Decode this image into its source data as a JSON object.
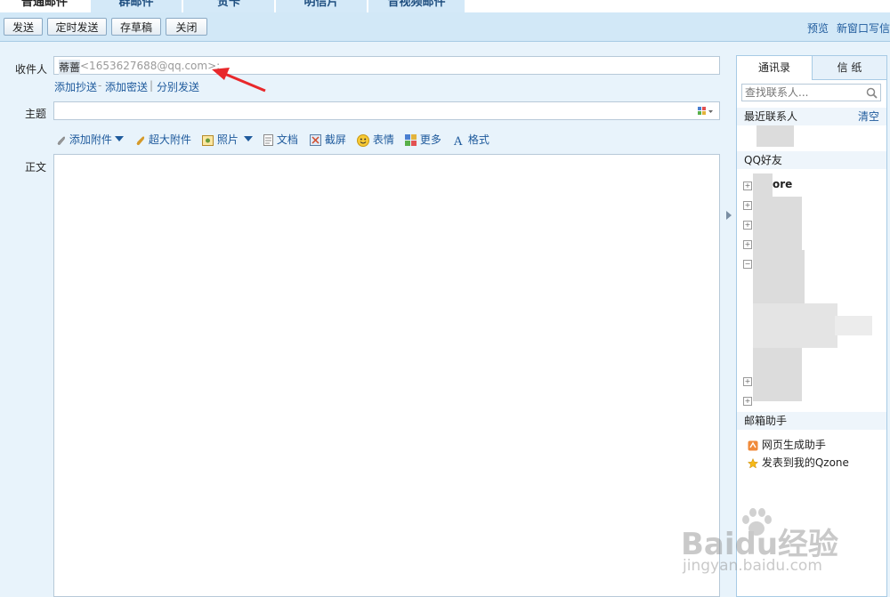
{
  "tabs": [
    "普通邮件",
    "群邮件",
    "贺卡",
    "明信片",
    "音视频邮件"
  ],
  "toolbar": {
    "send": "发送",
    "schedule_send": "定时发送",
    "save_draft": "存草稿",
    "close": "关闭",
    "preview": "预览",
    "new_window": "新窗口写信"
  },
  "compose": {
    "recipient_label": "收件人",
    "recipient_name": "蒂蔷",
    "recipient_email": "<1653627688@qq.com>;",
    "add_cc": "添加抄送",
    "add_bcc": "添加密送",
    "separate_send": "分别发送",
    "dash": "-",
    "pipe": "|",
    "subject_label": "主题",
    "body_label": "正文"
  },
  "tools": {
    "attachment": "添加附件",
    "big_attachment": "超大附件",
    "photo": "照片",
    "document": "文档",
    "screenshot": "截屏",
    "emoji": "表情",
    "more": "更多",
    "format": "格式"
  },
  "sidebar": {
    "tab_contacts": "通讯录",
    "tab_stationery": "信 纸",
    "search_placeholder": "查找联系人...",
    "recent_label": "最近联系人",
    "clear": "清空",
    "qq_friends": "QQ好友",
    "group_partial": "ore",
    "mailbox_helper": "邮箱助手",
    "helper_items": [
      "网页生成助手",
      "发表到我的Qzone"
    ]
  },
  "watermark": {
    "brand": "Baidu经验",
    "url": "jingyan.baidu.com"
  },
  "colors": {
    "accent": "#1e5a9c",
    "toolbar_bg": "#d2e8f7",
    "arrow": "#e8282b"
  }
}
